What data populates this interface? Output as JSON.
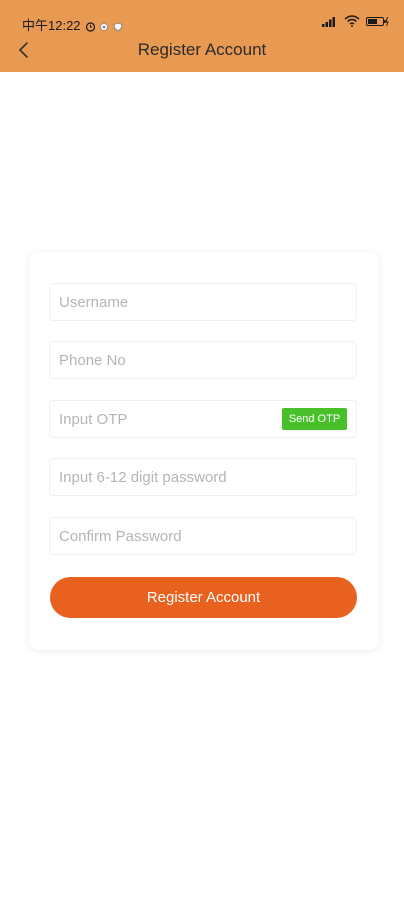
{
  "colors": {
    "header_bg": "#E89A52",
    "primary_button": "#E8611F",
    "otp_button": "#48C02A"
  },
  "status_bar": {
    "time": "中午12:22",
    "icons": [
      "alarm-icon",
      "notification-icon",
      "shield-icon"
    ],
    "right_icons": [
      "signal-icon",
      "wifi-icon",
      "battery-icon"
    ]
  },
  "nav": {
    "back_icon": "chevron-left-icon",
    "title": "Register Account"
  },
  "form": {
    "username": {
      "placeholder": "Username",
      "value": ""
    },
    "phone": {
      "placeholder": "Phone No",
      "value": ""
    },
    "otp": {
      "placeholder": "Input OTP",
      "value": "",
      "send_label": "Send OTP"
    },
    "password": {
      "placeholder": "Input 6-12 digit password",
      "value": ""
    },
    "confirm_password": {
      "placeholder": "Confirm Password",
      "value": ""
    },
    "submit_label": "Register Account"
  }
}
